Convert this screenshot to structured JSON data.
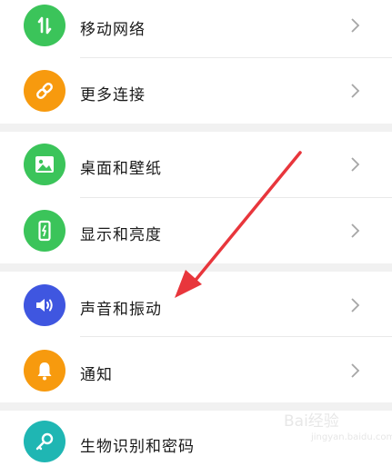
{
  "settings": {
    "items": [
      {
        "label": "移动网络",
        "icon": "mobile-data-icon",
        "color": "#3bc45a"
      },
      {
        "label": "更多连接",
        "icon": "link-icon",
        "color": "#f79a0e"
      },
      {
        "label": "桌面和壁纸",
        "icon": "image-icon",
        "color": "#3bc45a"
      },
      {
        "label": "显示和亮度",
        "icon": "phone-display-icon",
        "color": "#3bc45a"
      },
      {
        "label": "声音和振动",
        "icon": "speaker-icon",
        "color": "#3f56e0"
      },
      {
        "label": "通知",
        "icon": "bell-icon",
        "color": "#f79a0e"
      },
      {
        "label": "生物识别和密码",
        "icon": "key-icon",
        "color": "#1fb6b3"
      }
    ]
  },
  "annotation": {
    "arrow_color": "#e8363c"
  },
  "watermark": {
    "text": "Bai经验",
    "sub": "jingyan.baidu.com"
  }
}
